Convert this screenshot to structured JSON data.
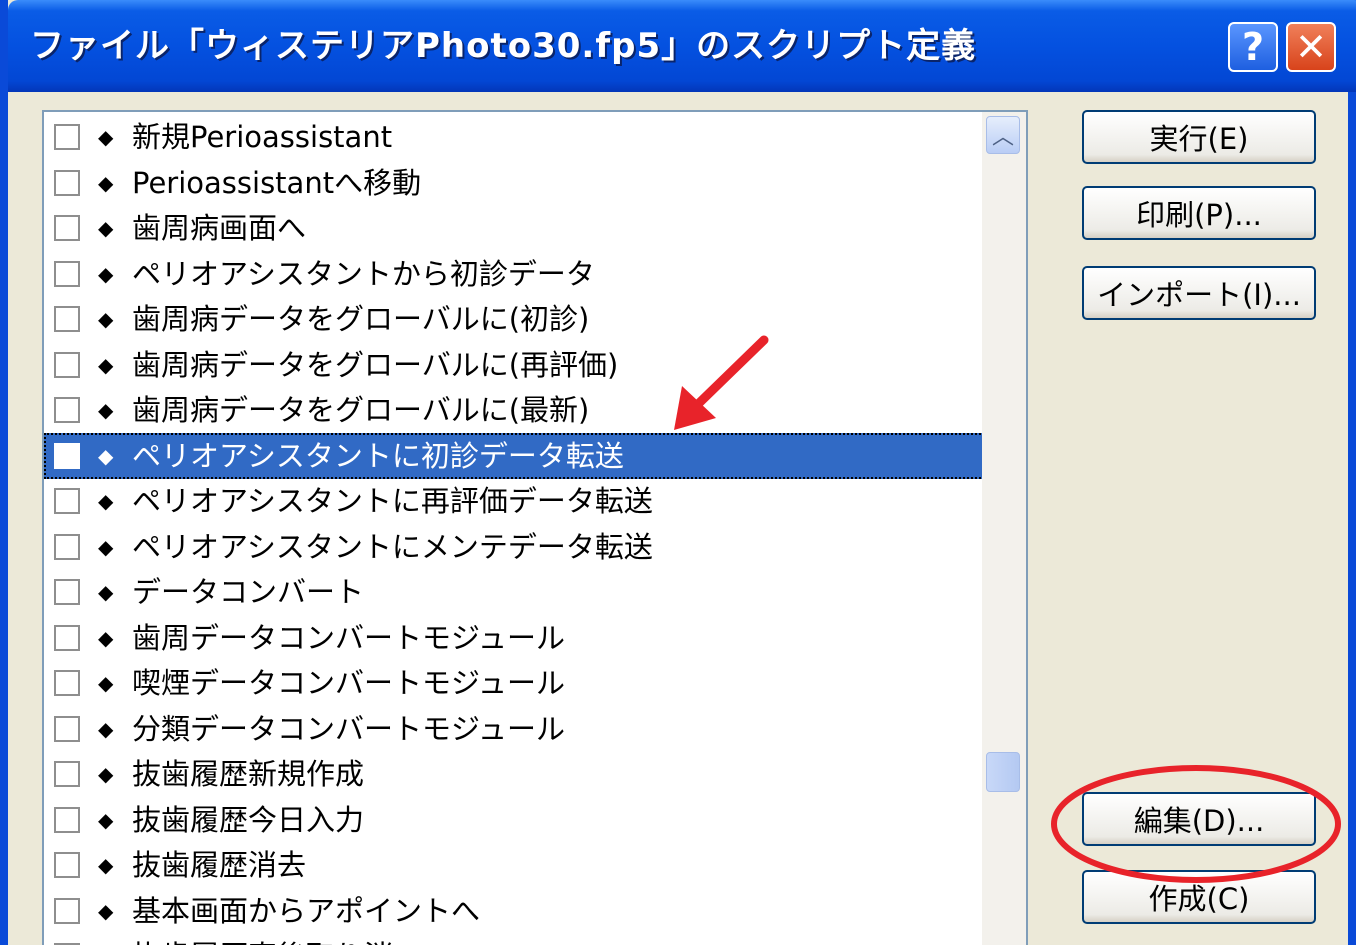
{
  "window": {
    "title": "ファイル「ウィステリアPhoto30.fp5」のスクリプト定義",
    "help_label": "?",
    "close_label": "✕",
    "title_color": "#0451e0"
  },
  "scripts": [
    {
      "label": "新規Perioassistant"
    },
    {
      "label": "Perioassistantへ移動"
    },
    {
      "label": "歯周病画面へ"
    },
    {
      "label": "ペリオアシスタントから初診データ"
    },
    {
      "label": "歯周病データをグローバルに(初診)"
    },
    {
      "label": "歯周病データをグローバルに(再評価)"
    },
    {
      "label": "歯周病データをグローバルに(最新)"
    },
    {
      "label": "ペリオアシスタントに初診データ転送"
    },
    {
      "label": "ペリオアシスタントに再評価データ転送"
    },
    {
      "label": "ペリオアシスタントにメンテデータ転送"
    },
    {
      "label": "データコンバート"
    },
    {
      "label": "歯周データコンバートモジュール"
    },
    {
      "label": "喫煙データコンバートモジュール"
    },
    {
      "label": "分類データコンバートモジュール"
    },
    {
      "label": "抜歯履歴新規作成"
    },
    {
      "label": "抜歯履歴今日入力"
    },
    {
      "label": "抜歯履歴消去"
    },
    {
      "label": "基本画面からアポイントへ"
    },
    {
      "label": "抜歯履歴直後取り消"
    }
  ],
  "selected_index": 7,
  "row_marker": "◆",
  "buttons": {
    "run": "実行(E)",
    "print": "印刷(P)...",
    "import": "インポート(I)...",
    "edit": "編集(D)...",
    "create": "作成(C)"
  },
  "annotation_color": "#e8232a",
  "selection_color": "#316ac5"
}
